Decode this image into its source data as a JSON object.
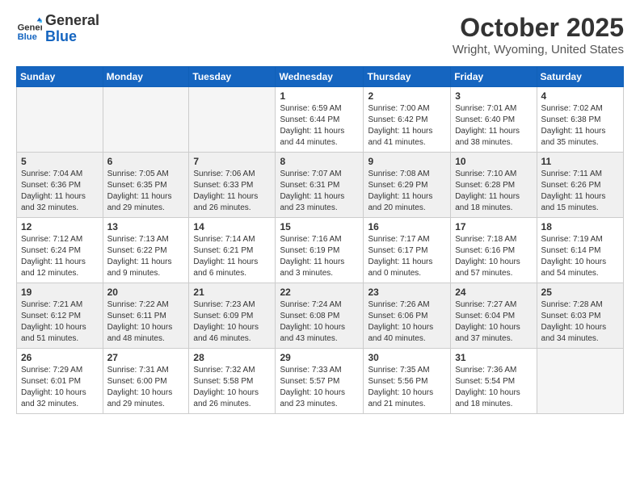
{
  "header": {
    "logo_general": "General",
    "logo_blue": "Blue",
    "title": "October 2025",
    "subtitle": "Wright, Wyoming, United States"
  },
  "weekdays": [
    "Sunday",
    "Monday",
    "Tuesday",
    "Wednesday",
    "Thursday",
    "Friday",
    "Saturday"
  ],
  "weeks": [
    [
      {
        "day": "",
        "sunrise": "",
        "sunset": "",
        "daylight": "",
        "empty": true
      },
      {
        "day": "",
        "sunrise": "",
        "sunset": "",
        "daylight": "",
        "empty": true
      },
      {
        "day": "",
        "sunrise": "",
        "sunset": "",
        "daylight": "",
        "empty": true
      },
      {
        "day": "1",
        "sunrise": "Sunrise: 6:59 AM",
        "sunset": "Sunset: 6:44 PM",
        "daylight": "Daylight: 11 hours and 44 minutes.",
        "empty": false
      },
      {
        "day": "2",
        "sunrise": "Sunrise: 7:00 AM",
        "sunset": "Sunset: 6:42 PM",
        "daylight": "Daylight: 11 hours and 41 minutes.",
        "empty": false
      },
      {
        "day": "3",
        "sunrise": "Sunrise: 7:01 AM",
        "sunset": "Sunset: 6:40 PM",
        "daylight": "Daylight: 11 hours and 38 minutes.",
        "empty": false
      },
      {
        "day": "4",
        "sunrise": "Sunrise: 7:02 AM",
        "sunset": "Sunset: 6:38 PM",
        "daylight": "Daylight: 11 hours and 35 minutes.",
        "empty": false
      }
    ],
    [
      {
        "day": "5",
        "sunrise": "Sunrise: 7:04 AM",
        "sunset": "Sunset: 6:36 PM",
        "daylight": "Daylight: 11 hours and 32 minutes.",
        "empty": false
      },
      {
        "day": "6",
        "sunrise": "Sunrise: 7:05 AM",
        "sunset": "Sunset: 6:35 PM",
        "daylight": "Daylight: 11 hours and 29 minutes.",
        "empty": false
      },
      {
        "day": "7",
        "sunrise": "Sunrise: 7:06 AM",
        "sunset": "Sunset: 6:33 PM",
        "daylight": "Daylight: 11 hours and 26 minutes.",
        "empty": false
      },
      {
        "day": "8",
        "sunrise": "Sunrise: 7:07 AM",
        "sunset": "Sunset: 6:31 PM",
        "daylight": "Daylight: 11 hours and 23 minutes.",
        "empty": false
      },
      {
        "day": "9",
        "sunrise": "Sunrise: 7:08 AM",
        "sunset": "Sunset: 6:29 PM",
        "daylight": "Daylight: 11 hours and 20 minutes.",
        "empty": false
      },
      {
        "day": "10",
        "sunrise": "Sunrise: 7:10 AM",
        "sunset": "Sunset: 6:28 PM",
        "daylight": "Daylight: 11 hours and 18 minutes.",
        "empty": false
      },
      {
        "day": "11",
        "sunrise": "Sunrise: 7:11 AM",
        "sunset": "Sunset: 6:26 PM",
        "daylight": "Daylight: 11 hours and 15 minutes.",
        "empty": false
      }
    ],
    [
      {
        "day": "12",
        "sunrise": "Sunrise: 7:12 AM",
        "sunset": "Sunset: 6:24 PM",
        "daylight": "Daylight: 11 hours and 12 minutes.",
        "empty": false
      },
      {
        "day": "13",
        "sunrise": "Sunrise: 7:13 AM",
        "sunset": "Sunset: 6:22 PM",
        "daylight": "Daylight: 11 hours and 9 minutes.",
        "empty": false
      },
      {
        "day": "14",
        "sunrise": "Sunrise: 7:14 AM",
        "sunset": "Sunset: 6:21 PM",
        "daylight": "Daylight: 11 hours and 6 minutes.",
        "empty": false
      },
      {
        "day": "15",
        "sunrise": "Sunrise: 7:16 AM",
        "sunset": "Sunset: 6:19 PM",
        "daylight": "Daylight: 11 hours and 3 minutes.",
        "empty": false
      },
      {
        "day": "16",
        "sunrise": "Sunrise: 7:17 AM",
        "sunset": "Sunset: 6:17 PM",
        "daylight": "Daylight: 11 hours and 0 minutes.",
        "empty": false
      },
      {
        "day": "17",
        "sunrise": "Sunrise: 7:18 AM",
        "sunset": "Sunset: 6:16 PM",
        "daylight": "Daylight: 10 hours and 57 minutes.",
        "empty": false
      },
      {
        "day": "18",
        "sunrise": "Sunrise: 7:19 AM",
        "sunset": "Sunset: 6:14 PM",
        "daylight": "Daylight: 10 hours and 54 minutes.",
        "empty": false
      }
    ],
    [
      {
        "day": "19",
        "sunrise": "Sunrise: 7:21 AM",
        "sunset": "Sunset: 6:12 PM",
        "daylight": "Daylight: 10 hours and 51 minutes.",
        "empty": false
      },
      {
        "day": "20",
        "sunrise": "Sunrise: 7:22 AM",
        "sunset": "Sunset: 6:11 PM",
        "daylight": "Daylight: 10 hours and 48 minutes.",
        "empty": false
      },
      {
        "day": "21",
        "sunrise": "Sunrise: 7:23 AM",
        "sunset": "Sunset: 6:09 PM",
        "daylight": "Daylight: 10 hours and 46 minutes.",
        "empty": false
      },
      {
        "day": "22",
        "sunrise": "Sunrise: 7:24 AM",
        "sunset": "Sunset: 6:08 PM",
        "daylight": "Daylight: 10 hours and 43 minutes.",
        "empty": false
      },
      {
        "day": "23",
        "sunrise": "Sunrise: 7:26 AM",
        "sunset": "Sunset: 6:06 PM",
        "daylight": "Daylight: 10 hours and 40 minutes.",
        "empty": false
      },
      {
        "day": "24",
        "sunrise": "Sunrise: 7:27 AM",
        "sunset": "Sunset: 6:04 PM",
        "daylight": "Daylight: 10 hours and 37 minutes.",
        "empty": false
      },
      {
        "day": "25",
        "sunrise": "Sunrise: 7:28 AM",
        "sunset": "Sunset: 6:03 PM",
        "daylight": "Daylight: 10 hours and 34 minutes.",
        "empty": false
      }
    ],
    [
      {
        "day": "26",
        "sunrise": "Sunrise: 7:29 AM",
        "sunset": "Sunset: 6:01 PM",
        "daylight": "Daylight: 10 hours and 32 minutes.",
        "empty": false
      },
      {
        "day": "27",
        "sunrise": "Sunrise: 7:31 AM",
        "sunset": "Sunset: 6:00 PM",
        "daylight": "Daylight: 10 hours and 29 minutes.",
        "empty": false
      },
      {
        "day": "28",
        "sunrise": "Sunrise: 7:32 AM",
        "sunset": "Sunset: 5:58 PM",
        "daylight": "Daylight: 10 hours and 26 minutes.",
        "empty": false
      },
      {
        "day": "29",
        "sunrise": "Sunrise: 7:33 AM",
        "sunset": "Sunset: 5:57 PM",
        "daylight": "Daylight: 10 hours and 23 minutes.",
        "empty": false
      },
      {
        "day": "30",
        "sunrise": "Sunrise: 7:35 AM",
        "sunset": "Sunset: 5:56 PM",
        "daylight": "Daylight: 10 hours and 21 minutes.",
        "empty": false
      },
      {
        "day": "31",
        "sunrise": "Sunrise: 7:36 AM",
        "sunset": "Sunset: 5:54 PM",
        "daylight": "Daylight: 10 hours and 18 minutes.",
        "empty": false
      },
      {
        "day": "",
        "sunrise": "",
        "sunset": "",
        "daylight": "",
        "empty": true
      }
    ]
  ]
}
